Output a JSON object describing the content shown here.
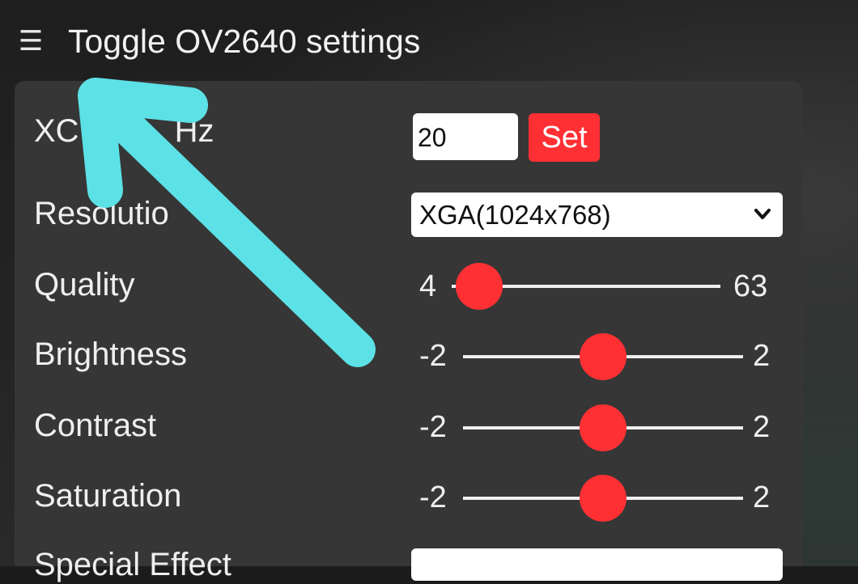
{
  "header": {
    "menu_icon": "hamburger-menu-icon",
    "title": "Toggle OV2640 settings"
  },
  "settings": {
    "xclk": {
      "label": "XCLK MHz",
      "visible_label": "XC",
      "visible_suffix": "Hz",
      "value": "20",
      "set_label": "Set"
    },
    "resolution": {
      "label": "Resolution",
      "visible_label": "Resolutio",
      "selected": "XGA(1024x768)"
    },
    "sliders": [
      {
        "label": "Quality",
        "min": "4",
        "max": "63",
        "value": 10
      },
      {
        "label": "Brightness",
        "min": "-2",
        "max": "2",
        "value": 0
      },
      {
        "label": "Contrast",
        "min": "-2",
        "max": "2",
        "value": 0
      },
      {
        "label": "Saturation",
        "min": "-2",
        "max": "2",
        "value": 0
      }
    ],
    "special_effect": {
      "label": "Special Effect"
    }
  },
  "colors": {
    "accent": "#ff3034",
    "panel": "#363636",
    "annotation_arrow": "#5ce1e6"
  },
  "annotation": {
    "icon": "up-left-arrow-icon"
  }
}
